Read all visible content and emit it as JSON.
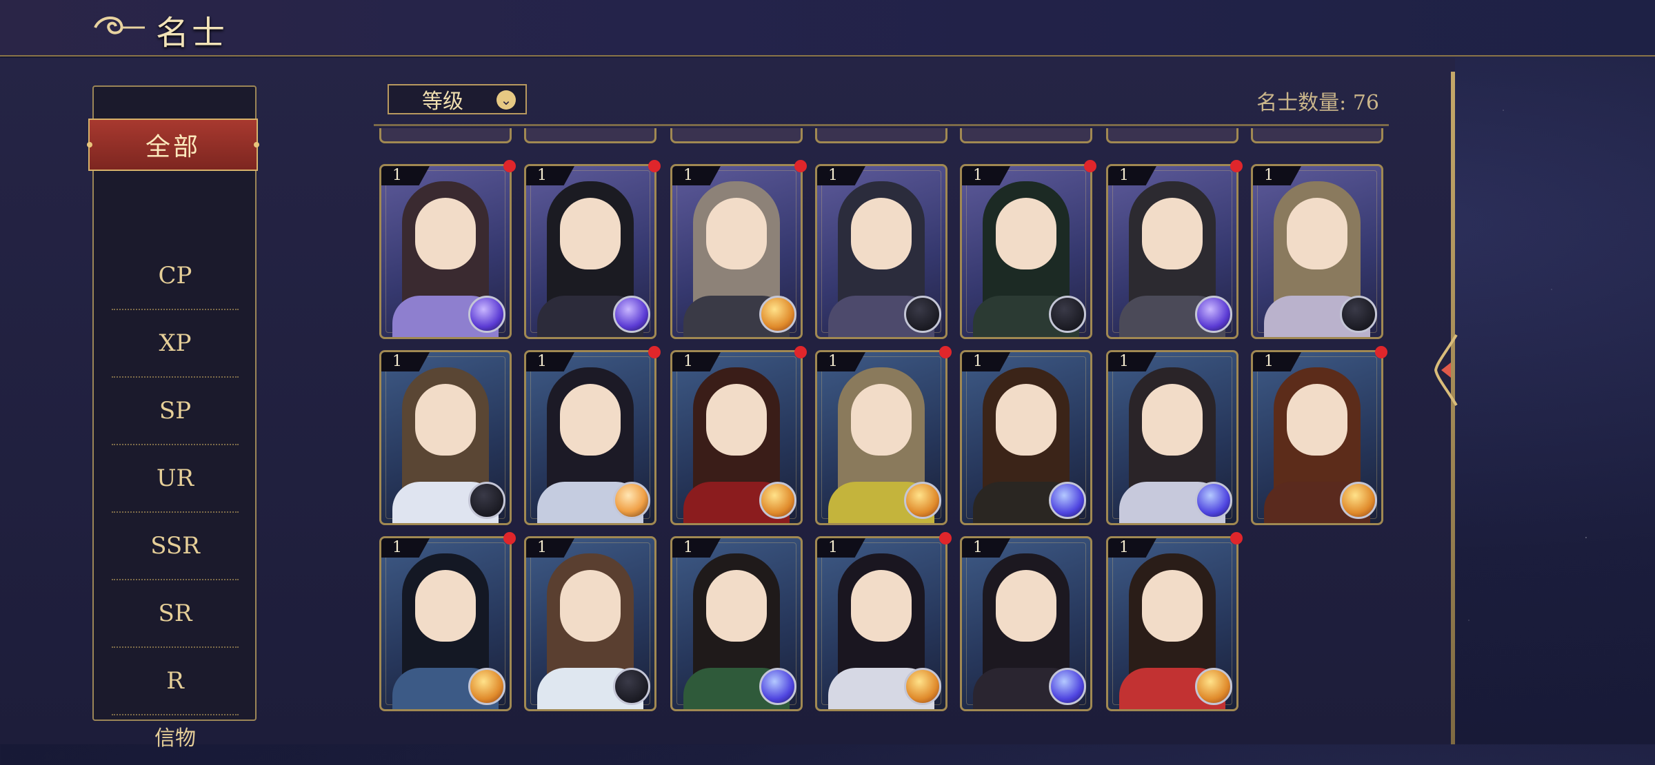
{
  "header": {
    "title": "名士"
  },
  "sidebar": {
    "active": "全部",
    "items": [
      "CP",
      "XP",
      "SP",
      "UR",
      "SSR",
      "SR",
      "R",
      "信物"
    ]
  },
  "toolbar": {
    "sort_label": "等级",
    "count_text": "名士数量: 76"
  },
  "cards": [
    {
      "level": "1",
      "badge": "purple",
      "notif": true,
      "hair": "#3a2a30",
      "body": "#8e7fcf"
    },
    {
      "level": "1",
      "badge": "purple",
      "notif": true,
      "hair": "#1b1b22",
      "body": "#2c2b3a"
    },
    {
      "level": "1",
      "badge": "gold",
      "notif": true,
      "hair": "#8d8278",
      "body": "#3a3a46"
    },
    {
      "level": "1",
      "badge": "silver",
      "notif": false,
      "hair": "#2b2c3c",
      "body": "#4d4a6c"
    },
    {
      "level": "1",
      "badge": "silver",
      "notif": true,
      "hair": "#1c2a24",
      "body": "#2b3a33"
    },
    {
      "level": "1",
      "badge": "purple",
      "notif": true,
      "hair": "#2c2a30",
      "body": "#4b4a58"
    },
    {
      "level": "1",
      "badge": "silver",
      "notif": false,
      "hair": "#8a7a5e",
      "body": "#bab2cc"
    },
    {
      "level": "1",
      "badge": "silver",
      "notif": false,
      "hair": "#5a4634",
      "body": "#dfe4f0"
    },
    {
      "level": "1",
      "badge": "orange",
      "notif": true,
      "hair": "#1c1a26",
      "body": "#c5cce0"
    },
    {
      "level": "1",
      "badge": "gold",
      "notif": true,
      "hair": "#3a1d18",
      "body": "#8b1c1e"
    },
    {
      "level": "1",
      "badge": "gold",
      "notif": true,
      "hair": "#8a7a5c",
      "body": "#c4b43c"
    },
    {
      "level": "1",
      "badge": "violet",
      "notif": false,
      "hair": "#3b2418",
      "body": "#2a2622"
    },
    {
      "level": "1",
      "badge": "violet",
      "notif": false,
      "hair": "#2a2428",
      "body": "#c7c9dc"
    },
    {
      "level": "1",
      "badge": "gold",
      "notif": true,
      "hair": "#5c2c1a",
      "body": "#5a2a1e"
    },
    {
      "level": "1",
      "badge": "gold",
      "notif": true,
      "hair": "#141824",
      "body": "#3c5a86"
    },
    {
      "level": "1",
      "badge": "silver",
      "notif": false,
      "hair": "#5a3f30",
      "body": "#dfe7f0"
    },
    {
      "level": "1",
      "badge": "violet",
      "notif": false,
      "hair": "#1f1a1a",
      "body": "#2f5a3a"
    },
    {
      "level": "1",
      "badge": "gold",
      "notif": true,
      "hair": "#1a1620",
      "body": "#d6d8e4"
    },
    {
      "level": "1",
      "badge": "violet",
      "notif": false,
      "hair": "#1c1820",
      "body": "#2a2530"
    },
    {
      "level": "1",
      "badge": "gold",
      "notif": true,
      "hair": "#2a1d18",
      "body": "#c23232"
    }
  ],
  "partial_row_count": 7
}
